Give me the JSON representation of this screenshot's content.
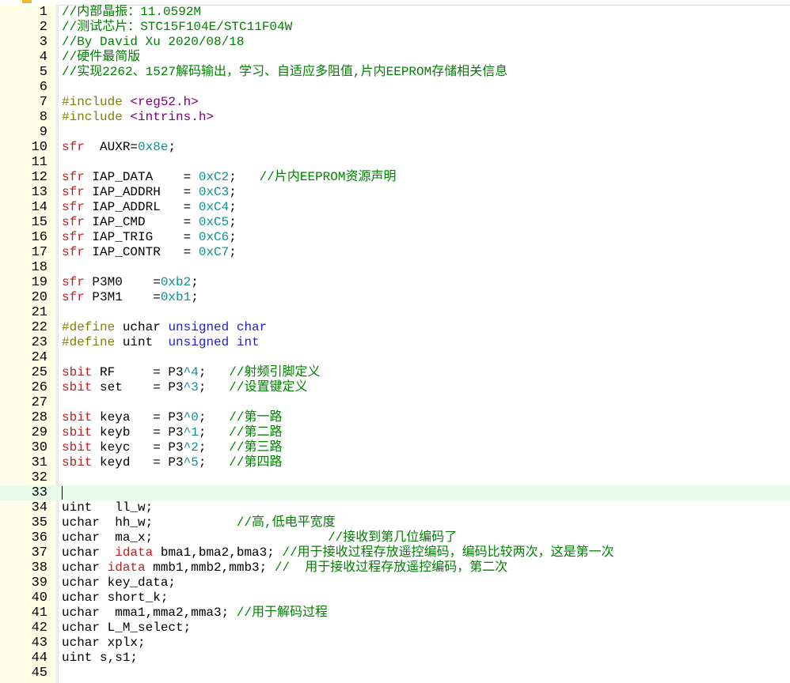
{
  "colors": {
    "keyword": "#c02020",
    "type": "#1f1fd8",
    "number": "#109090",
    "comment": "#008000",
    "preprocessor": "#808000",
    "include_path": "#800080",
    "gutter_bg": "#ffffe8",
    "current_line": "#e8fbe8"
  },
  "editor": {
    "current_line": 33,
    "lines": [
      {
        "n": "1",
        "t": [
          [
            "cm",
            "//内部晶振：11.0592M"
          ]
        ]
      },
      {
        "n": "2",
        "t": [
          [
            "cm",
            "//测试芯片：STC15F104E/STC11F04W"
          ]
        ]
      },
      {
        "n": "3",
        "t": [
          [
            "cm",
            "//By David Xu 2020/08/18"
          ]
        ]
      },
      {
        "n": "4",
        "t": [
          [
            "cm",
            "//硬件最简版"
          ]
        ]
      },
      {
        "n": "5",
        "t": [
          [
            "cm",
            "//实现2262、1527解码输出，学习、自适应多阻值,片内EEPROM存储相关信息"
          ]
        ]
      },
      {
        "n": "6",
        "t": []
      },
      {
        "n": "7",
        "t": [
          [
            "pp",
            "#include "
          ],
          [
            "ang",
            "<reg52.h>"
          ]
        ]
      },
      {
        "n": "8",
        "t": [
          [
            "pp",
            "#include "
          ],
          [
            "ang",
            "<intrins.h>"
          ]
        ]
      },
      {
        "n": "9",
        "t": []
      },
      {
        "n": "10",
        "t": [
          [
            "kw",
            "sfr"
          ],
          [
            "",
            "  AUXR="
          ],
          [
            "num",
            "0x8e"
          ],
          [
            "",
            ";"
          ]
        ]
      },
      {
        "n": "11",
        "t": []
      },
      {
        "n": "12",
        "t": [
          [
            "kw",
            "sfr"
          ],
          [
            "",
            " IAP_DATA    = "
          ],
          [
            "num",
            "0xC2"
          ],
          [
            "",
            ";   "
          ],
          [
            "cm",
            "//片内EEPROM资源声明"
          ]
        ]
      },
      {
        "n": "13",
        "t": [
          [
            "kw",
            "sfr"
          ],
          [
            "",
            " IAP_ADDRH   = "
          ],
          [
            "num",
            "0xC3"
          ],
          [
            "",
            ";"
          ]
        ]
      },
      {
        "n": "14",
        "t": [
          [
            "kw",
            "sfr"
          ],
          [
            "",
            " IAP_ADDRL   = "
          ],
          [
            "num",
            "0xC4"
          ],
          [
            "",
            ";"
          ]
        ]
      },
      {
        "n": "15",
        "t": [
          [
            "kw",
            "sfr"
          ],
          [
            "",
            " IAP_CMD     = "
          ],
          [
            "num",
            "0xC5"
          ],
          [
            "",
            ";"
          ]
        ]
      },
      {
        "n": "16",
        "t": [
          [
            "kw",
            "sfr"
          ],
          [
            "",
            " IAP_TRIG    = "
          ],
          [
            "num",
            "0xC6"
          ],
          [
            "",
            ";"
          ]
        ]
      },
      {
        "n": "17",
        "t": [
          [
            "kw",
            "sfr"
          ],
          [
            "",
            " IAP_CONTR   = "
          ],
          [
            "num",
            "0xC7"
          ],
          [
            "",
            ";"
          ]
        ]
      },
      {
        "n": "18",
        "t": []
      },
      {
        "n": "19",
        "t": [
          [
            "kw",
            "sfr"
          ],
          [
            "",
            " P3M0    ="
          ],
          [
            "num",
            "0xb2"
          ],
          [
            "",
            ";"
          ]
        ]
      },
      {
        "n": "20",
        "t": [
          [
            "kw",
            "sfr"
          ],
          [
            "",
            " P3M1    ="
          ],
          [
            "num",
            "0xb1"
          ],
          [
            "",
            ";"
          ]
        ]
      },
      {
        "n": "21",
        "t": []
      },
      {
        "n": "22",
        "t": [
          [
            "pp",
            "#define"
          ],
          [
            "",
            " uchar "
          ],
          [
            "type",
            "unsigned char"
          ]
        ]
      },
      {
        "n": "23",
        "t": [
          [
            "pp",
            "#define"
          ],
          [
            "",
            " uint  "
          ],
          [
            "type",
            "unsigned int"
          ]
        ]
      },
      {
        "n": "24",
        "t": []
      },
      {
        "n": "25",
        "t": [
          [
            "kw",
            "sbit"
          ],
          [
            "",
            " RF     = P3"
          ],
          [
            "num",
            "^4"
          ],
          [
            "",
            ";   "
          ],
          [
            "cm",
            "//射频引脚定义"
          ]
        ]
      },
      {
        "n": "26",
        "t": [
          [
            "kw",
            "sbit"
          ],
          [
            "",
            " set    = P3"
          ],
          [
            "num",
            "^3"
          ],
          [
            "",
            ";   "
          ],
          [
            "cm",
            "//设置键定义"
          ]
        ]
      },
      {
        "n": "27",
        "t": []
      },
      {
        "n": "28",
        "t": [
          [
            "kw",
            "sbit"
          ],
          [
            "",
            " keya   = P3"
          ],
          [
            "num",
            "^0"
          ],
          [
            "",
            ";   "
          ],
          [
            "cm",
            "//第一路"
          ]
        ]
      },
      {
        "n": "29",
        "t": [
          [
            "kw",
            "sbit"
          ],
          [
            "",
            " keyb   = P3"
          ],
          [
            "num",
            "^1"
          ],
          [
            "",
            ";   "
          ],
          [
            "cm",
            "//第二路"
          ]
        ]
      },
      {
        "n": "30",
        "t": [
          [
            "kw",
            "sbit"
          ],
          [
            "",
            " keyc   = P3"
          ],
          [
            "num",
            "^2"
          ],
          [
            "",
            ";   "
          ],
          [
            "cm",
            "//第三路"
          ]
        ]
      },
      {
        "n": "31",
        "t": [
          [
            "kw",
            "sbit"
          ],
          [
            "",
            " keyd   = P3"
          ],
          [
            "num",
            "^5"
          ],
          [
            "",
            ";   "
          ],
          [
            "cm",
            "//第四路"
          ]
        ]
      },
      {
        "n": "32",
        "t": []
      },
      {
        "n": "33",
        "t": []
      },
      {
        "n": "34",
        "t": [
          [
            "",
            "uint   ll_w;"
          ]
        ]
      },
      {
        "n": "35",
        "t": [
          [
            "",
            "uchar  hh_w;           "
          ],
          [
            "cm",
            "//高,低电平宽度"
          ]
        ]
      },
      {
        "n": "36",
        "t": [
          [
            "",
            "uchar  ma_x;                       "
          ],
          [
            "cm",
            "//接收到第几位编码了"
          ]
        ]
      },
      {
        "n": "37",
        "t": [
          [
            "",
            "uchar  "
          ],
          [
            "kw",
            "idata"
          ],
          [
            "",
            " bma1,bma2,bma3; "
          ],
          [
            "cm",
            "//用于接收过程存放遥控编码，编码比较两次，这是第一次"
          ]
        ]
      },
      {
        "n": "38",
        "t": [
          [
            "",
            "uchar "
          ],
          [
            "kw",
            "idata"
          ],
          [
            "",
            " mmb1,mmb2,mmb3; "
          ],
          [
            "cm",
            "//  用于接收过程存放遥控编码，第二次"
          ]
        ]
      },
      {
        "n": "39",
        "t": [
          [
            "",
            "uchar key_data;"
          ]
        ]
      },
      {
        "n": "40",
        "t": [
          [
            "",
            "uchar short_k;"
          ]
        ]
      },
      {
        "n": "41",
        "t": [
          [
            "",
            "uchar  mma1,mma2,mma3; "
          ],
          [
            "cm",
            "//用于解码过程"
          ]
        ]
      },
      {
        "n": "42",
        "t": [
          [
            "",
            "uchar L_M_select;"
          ]
        ]
      },
      {
        "n": "43",
        "t": [
          [
            "",
            "uchar xplx;"
          ]
        ]
      },
      {
        "n": "44",
        "t": [
          [
            "",
            "uint s,s1;"
          ]
        ]
      },
      {
        "n": "45",
        "t": []
      }
    ]
  }
}
